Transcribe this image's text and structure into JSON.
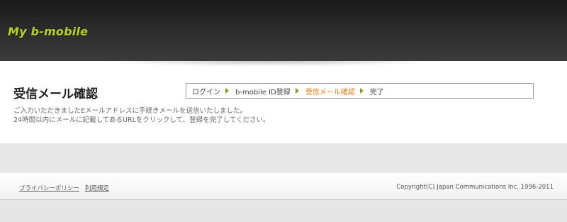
{
  "header": {
    "logo_text": "My b-mobile"
  },
  "main": {
    "title": "受信メール確認",
    "breadcrumb": [
      {
        "label": "ログイン",
        "current": false
      },
      {
        "label": "b-mobile ID登録",
        "current": false
      },
      {
        "label": "受信メール確認",
        "current": true
      },
      {
        "label": "完了",
        "current": false
      }
    ],
    "message_line1": "ご入力いただきましたEメールアドレスに手続きメールを送信いたしました。",
    "message_line2": "24時間以内にメールに記載してあるURLをクリックして、登録を完了してください。"
  },
  "footer": {
    "privacy_link": "プライバシーポリシー",
    "terms_link": "利用規定",
    "copyright": "Copyright(C) Japan Communications Inc. 1996-2011"
  },
  "colors": {
    "logo": "#b8d12a",
    "current_step": "#e07a10",
    "arrow": "#7da02a"
  }
}
